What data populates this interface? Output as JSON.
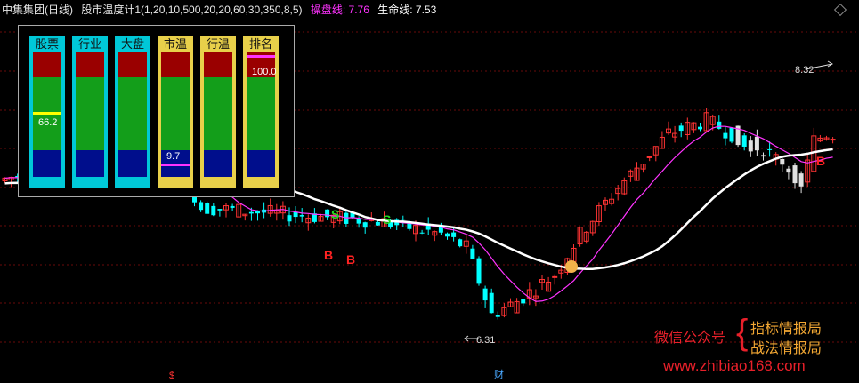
{
  "title": {
    "stock_name": "中集集团(日线)",
    "indicator": "股市温度计1(1,20,10,500,20,20,60,30,350,8,5)",
    "line1_label": "操盘线: 7.76",
    "line2_label": "生命线: 7.53"
  },
  "panel": {
    "columns": [
      {
        "label": "股票",
        "frame": "#00c8d8",
        "marker_color": "#ffff00",
        "marker_pct": 0.48,
        "value": "66.2"
      },
      {
        "label": "行业",
        "frame": "#00c8d8",
        "marker_color": "",
        "marker_pct": null,
        "value": ""
      },
      {
        "label": "大盘",
        "frame": "#00c8d8",
        "marker_color": "",
        "marker_pct": null,
        "value": ""
      },
      {
        "label": "市温",
        "frame": "#e8d04a",
        "marker_color": "#ff33ff",
        "marker_pct": 0.89,
        "value": "9.7"
      },
      {
        "label": "行温",
        "frame": "#e8d04a",
        "marker_color": "",
        "marker_pct": null,
        "value": ""
      },
      {
        "label": "排名",
        "frame": "#e8d04a",
        "marker_color": "#ff33ff",
        "marker_pct": 0.02,
        "value": "100.0"
      }
    ]
  },
  "annotations": {
    "high_price": "8.32",
    "low_price": "6.31",
    "signals": [
      "S",
      "S",
      "B",
      "B",
      "B"
    ]
  },
  "colors": {
    "up": "#ff3333",
    "down": "#00ffff",
    "line1": "#ff33ff",
    "line2": "#ffffff",
    "flat": "#e0e0e0"
  },
  "bottom_marks": {
    "left": "$",
    "center": "财"
  },
  "watermark": {
    "wechat": "微信公众号",
    "brace": "{",
    "line1": "指标情报局",
    "line2": "战法情报局",
    "url": "www.zhibiao168.com"
  }
}
